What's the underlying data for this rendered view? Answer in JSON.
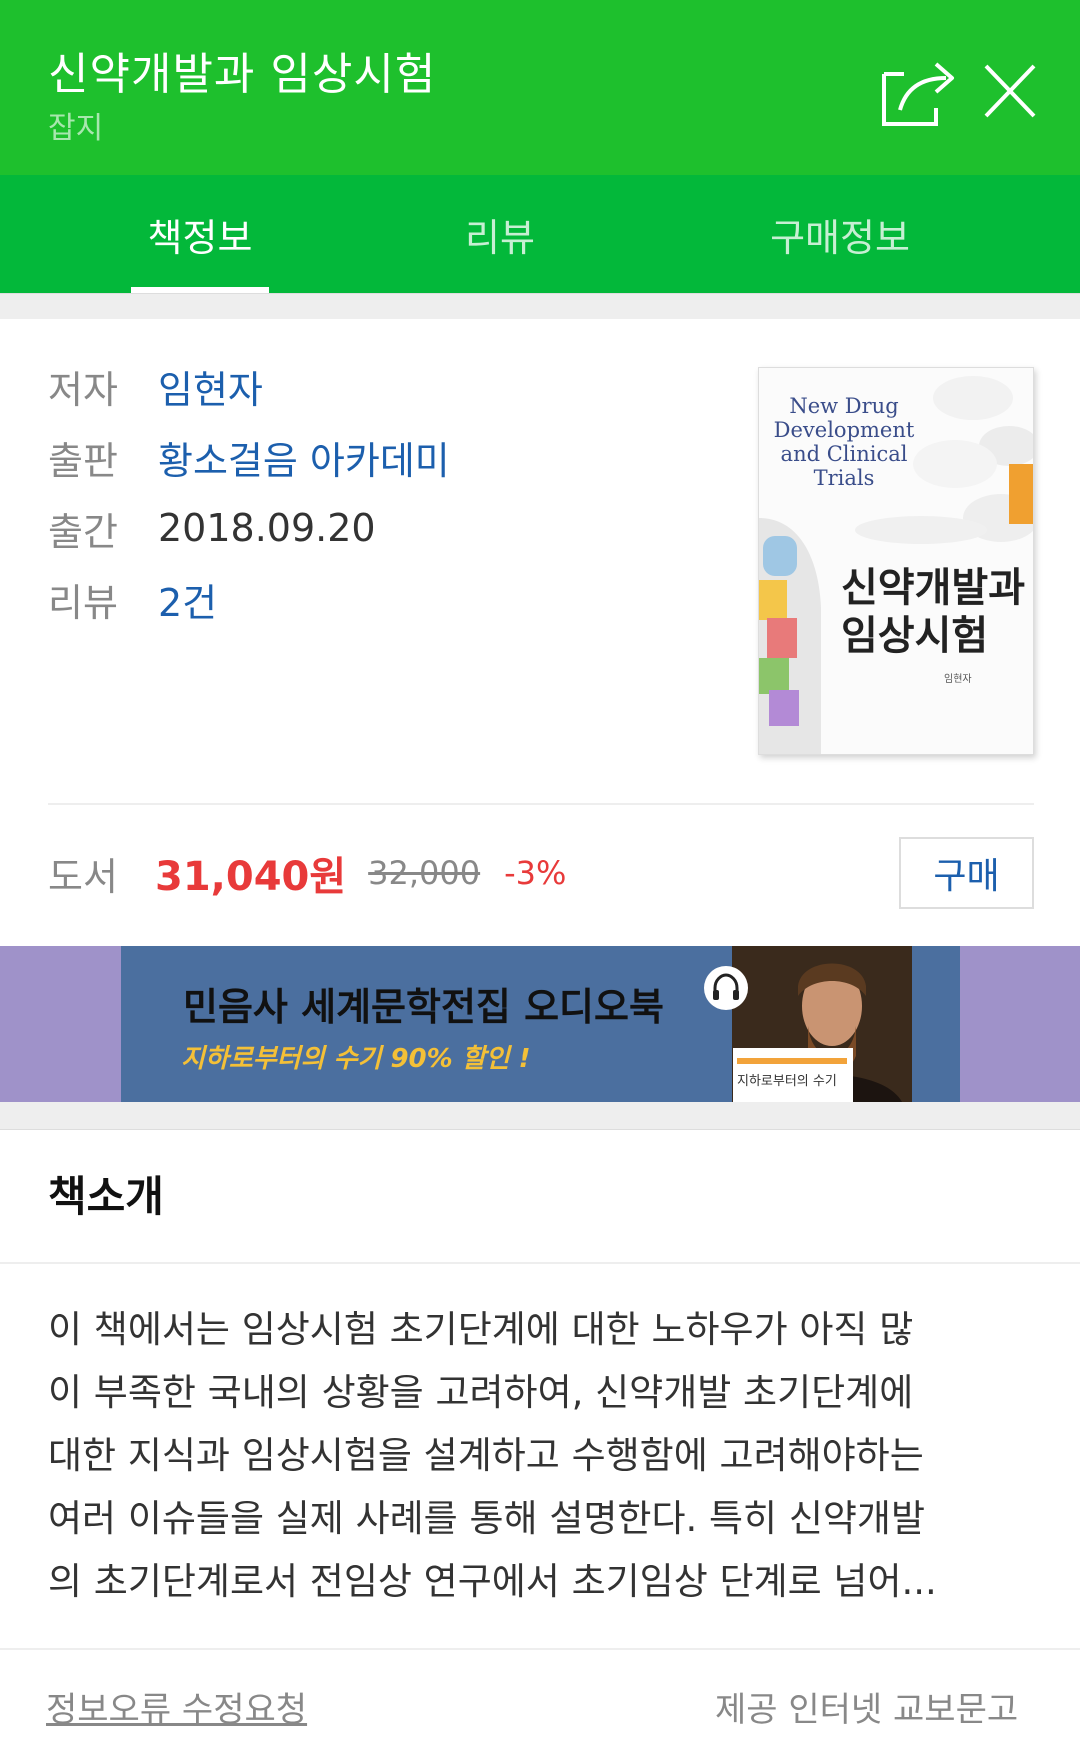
{
  "header": {
    "title": "신약개발과 임상시험",
    "subtitle": "잡지"
  },
  "tabs": [
    {
      "label": "책정보",
      "active": true
    },
    {
      "label": "리뷰",
      "active": false
    },
    {
      "label": "구매정보",
      "active": false
    }
  ],
  "info": {
    "author_label": "저자",
    "author": "임현자",
    "publisher_label": "출판",
    "publisher": "황소걸음 아카데미",
    "date_label": "출간",
    "date": "2018.09.20",
    "review_label": "리뷰",
    "review_count": "2건"
  },
  "cover": {
    "title_en_lines": [
      "New Drug",
      "Development",
      "and Clinical",
      "Trials"
    ],
    "title_ko_lines": [
      "신약개발과",
      "임상시험"
    ]
  },
  "price": {
    "label": "도서",
    "sale_price": "31,040원",
    "original_price": "32,000",
    "discount": "-3%",
    "buy_button": "구매"
  },
  "banner": {
    "title": "민음사 세계문학전집 오디오북",
    "subtitle": "지하로부터의 수기 90% 할인 !",
    "book_caption": "지하로부터의 수기"
  },
  "intro": {
    "title": "책소개",
    "lines": [
      "이 책에서는 임상시험 초기단계에 대한 노하우가 아직 많",
      "이 부족한 국내의 상황을 고려하여, 신약개발 초기단계에",
      "대한 지식과 임상시험을 설계하고 수행함에 고려해야하는",
      "여러 이슈들을 실제 사례를 통해 설명한다. 특히 신약개발",
      "의 초기단계로서 전임상 연구에서 초기임상 단계로 넘어..."
    ]
  },
  "footer": {
    "report_link": "정보오류 수정요청",
    "provider": "제공 인터넷 교보문고"
  },
  "colors": {
    "header_green": "#1ec02d",
    "tab_green": "#03b83a",
    "link_blue": "#1c5fad",
    "price_red": "#e83a3a",
    "banner_blue": "#4b6f9f",
    "banner_purple": "#9f92c9"
  }
}
